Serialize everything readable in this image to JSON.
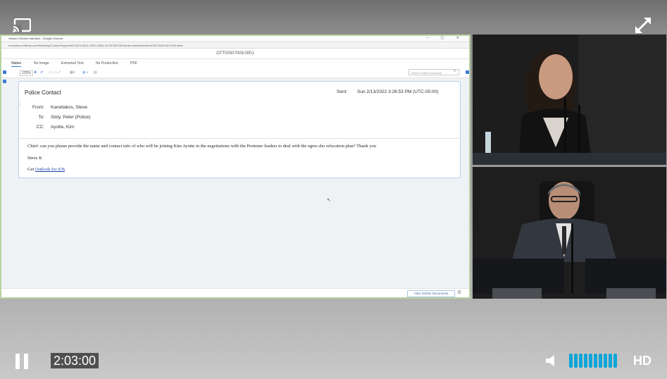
{
  "window": {
    "title": "Viewer | Review Interface - Google Chrome",
    "url": "heuristica.relativity.com/Relativity/CustomPages/4d014875-8301-45FE-9806-3C20C33F2603/externaldatalistview/37807038/1451978/native"
  },
  "document": {
    "control_number": "OTT00007009.0001",
    "tabs": [
      "Native",
      "No Image",
      "Extracted Text",
      "No Production",
      "PDF"
    ],
    "active_tab": "Native",
    "zoom": "125%",
    "search_placeholder": "Search within Document",
    "footer_button": "View Similar Documents"
  },
  "email": {
    "subject": "Police Contact",
    "sent_label": "Sent:",
    "sent_value": "Sun 2/13/2022 3:26:53 PM (UTC-05:00)",
    "from_label": "From:",
    "from_value": "Kanellakos, Steve",
    "to_label": "To:",
    "to_value": "Sloly, Peter (Police)",
    "cc_label": "CC:",
    "cc_value": "Ayotte, Kim",
    "body_line1": "Chief: can you please provide the name and contact info of who will be joining Kim Ayotte in the negotiations with the Protester leaders to deal with the egres sbo relocation plan? Thank you",
    "body_line2": "Steve K",
    "body_line3_prefix": "Get",
    "body_line3_link": "Outlook for iOS"
  },
  "player": {
    "timestamp": "2:03:00",
    "quality": "HD",
    "volume_level": 1.0,
    "accent_color": "#0ea5d8"
  }
}
